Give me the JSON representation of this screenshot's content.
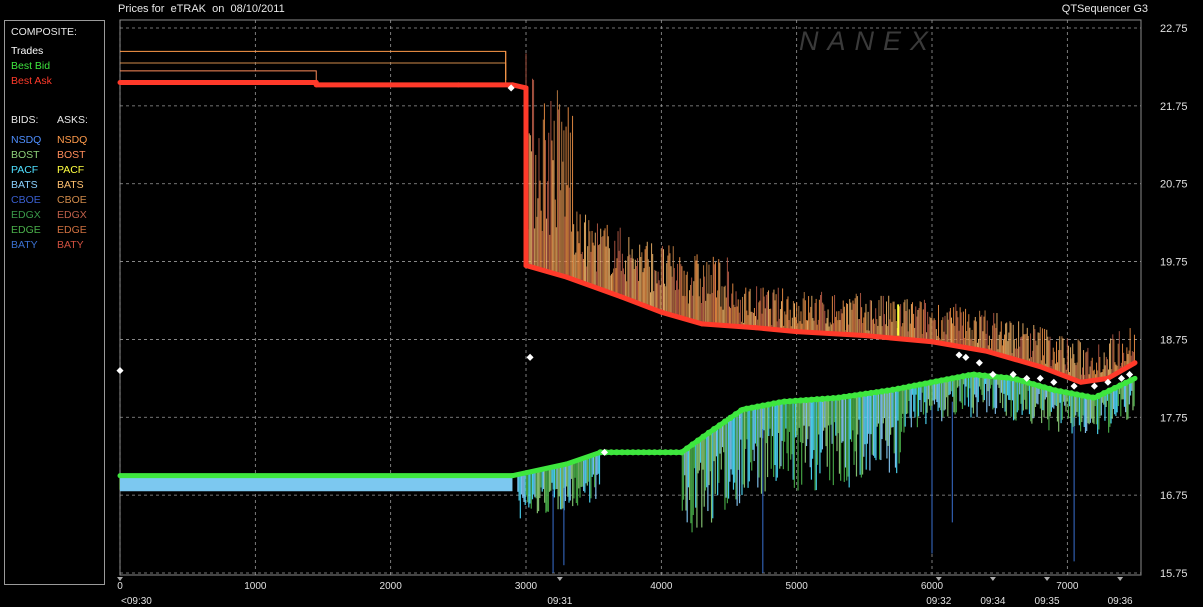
{
  "header": {
    "title": "Prices for  eTRAK  on  08/10/2011",
    "app_name": "QTSequencer G3",
    "watermark": "NANEX"
  },
  "legend": {
    "composite_heading": "COMPOSITE:",
    "composite": [
      {
        "label": "Trades",
        "color": "#ffffff"
      },
      {
        "label": "Best Bid",
        "color": "#3ee63e"
      },
      {
        "label": "Best Ask",
        "color": "#ff3a2a"
      }
    ],
    "bids_heading": "BIDS:",
    "asks_heading": "ASKS:",
    "exchanges": [
      {
        "bid": "NSDQ",
        "bid_color": "#4f8fff",
        "ask": "NSDQ",
        "ask_color": "#ff9a4a"
      },
      {
        "bid": "BOST",
        "bid_color": "#8ed17a",
        "ask": "BOST",
        "ask_color": "#ff8c5a"
      },
      {
        "bid": "PACF",
        "bid_color": "#4fe0ff",
        "ask": "PACF",
        "ask_color": "#ffff40"
      },
      {
        "bid": "BATS",
        "bid_color": "#8ad0ff",
        "ask": "BATS",
        "ask_color": "#ffc070"
      },
      {
        "bid": "CBOE",
        "bid_color": "#3a5fd0",
        "ask": "CBOE",
        "ask_color": "#d08a4a"
      },
      {
        "bid": "EDGX",
        "bid_color": "#3a9a4a",
        "ask": "EDGX",
        "ask_color": "#c0604a"
      },
      {
        "bid": "EDGE",
        "bid_color": "#4ab04a",
        "ask": "EDGE",
        "ask_color": "#d07040"
      },
      {
        "bid": "BATY",
        "bid_color": "#3a70d0",
        "ask": "BATY",
        "ask_color": "#d05040"
      }
    ]
  },
  "chart_data": {
    "type": "line",
    "title": "Prices for  eTRAK  on  08/10/2011",
    "xlabel": "",
    "ylabel": "",
    "x_range": [
      0,
      7500
    ],
    "y_range": [
      15.75,
      22.75
    ],
    "x_ticks": [
      0,
      1000,
      2000,
      3000,
      4000,
      5000,
      6000,
      7000
    ],
    "y_ticks": [
      15.75,
      16.75,
      17.75,
      18.75,
      19.75,
      20.75,
      21.75,
      22.75
    ],
    "y_tick_labels": [
      "15.75",
      "16.75",
      "17.75",
      "18.75",
      "19.75",
      "20.75",
      "21.75",
      "22.75"
    ],
    "time_labels": [
      {
        "x": 0,
        "label": "<09:30"
      },
      {
        "x": 3250,
        "label": "09:31"
      },
      {
        "x": 6050,
        "label": "09:32"
      },
      {
        "x": 6450,
        "label": "09:34"
      },
      {
        "x": 6850,
        "label": "09:35"
      },
      {
        "x": 7390,
        "label": "09:36"
      }
    ],
    "grid": true,
    "series": [
      {
        "name": "Best Ask",
        "color": "#ff3a2a",
        "points": [
          [
            0,
            22.05
          ],
          [
            1450,
            22.05
          ],
          [
            1450,
            22.02
          ],
          [
            2500,
            22.02
          ],
          [
            2900,
            22.02
          ],
          [
            3000,
            21.98
          ],
          [
            3000,
            19.7
          ],
          [
            3300,
            19.55
          ],
          [
            3700,
            19.3
          ],
          [
            4000,
            19.1
          ],
          [
            4300,
            18.95
          ],
          [
            4700,
            18.9
          ],
          [
            5000,
            18.85
          ],
          [
            5500,
            18.8
          ],
          [
            6000,
            18.72
          ],
          [
            6400,
            18.6
          ],
          [
            6800,
            18.4
          ],
          [
            7100,
            18.2
          ],
          [
            7300,
            18.25
          ],
          [
            7500,
            18.45
          ]
        ]
      },
      {
        "name": "Best Bid",
        "color": "#3ee63e",
        "points": [
          [
            0,
            17.0
          ],
          [
            2900,
            17.0
          ],
          [
            3300,
            17.15
          ],
          [
            3550,
            17.3
          ],
          [
            3550,
            17.3
          ],
          [
            4150,
            17.3
          ],
          [
            4350,
            17.55
          ],
          [
            4600,
            17.85
          ],
          [
            4900,
            17.95
          ],
          [
            5300,
            18.0
          ],
          [
            5700,
            18.1
          ],
          [
            6000,
            18.2
          ],
          [
            6300,
            18.3
          ],
          [
            6600,
            18.25
          ],
          [
            6900,
            18.1
          ],
          [
            7200,
            18.0
          ],
          [
            7500,
            18.25
          ]
        ]
      },
      {
        "name": "Trades",
        "color": "#ffffff",
        "points": [
          [
            0,
            18.35
          ],
          [
            3030,
            18.52
          ],
          [
            3580,
            17.3
          ],
          [
            6200,
            18.55
          ],
          [
            6250,
            18.52
          ],
          [
            6350,
            18.45
          ],
          [
            6450,
            18.3
          ],
          [
            6600,
            18.3
          ],
          [
            6700,
            18.25
          ],
          [
            6800,
            18.25
          ],
          [
            6900,
            18.2
          ],
          [
            7050,
            18.15
          ],
          [
            7200,
            18.15
          ],
          [
            7300,
            18.2
          ],
          [
            7400,
            18.25
          ],
          [
            7460,
            18.3
          ],
          [
            2890,
            21.98
          ]
        ]
      }
    ]
  }
}
